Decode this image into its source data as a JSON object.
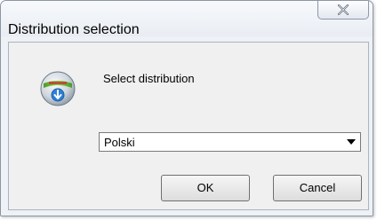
{
  "window": {
    "title": "Distribution selection"
  },
  "dialog": {
    "prompt": "Select distribution",
    "distribution_select": {
      "selected": "Polski"
    },
    "buttons": {
      "ok": "OK",
      "cancel": "Cancel"
    }
  },
  "icons": {
    "app": "distribution-install-icon",
    "close": "close-icon",
    "dropdown": "chevron-down-icon"
  },
  "colors": {
    "window_bg": "#eef1f5",
    "client_bg": "#f0f0f0",
    "icon_blue": "#2f7fd8",
    "icon_green": "#6fbf3a"
  }
}
